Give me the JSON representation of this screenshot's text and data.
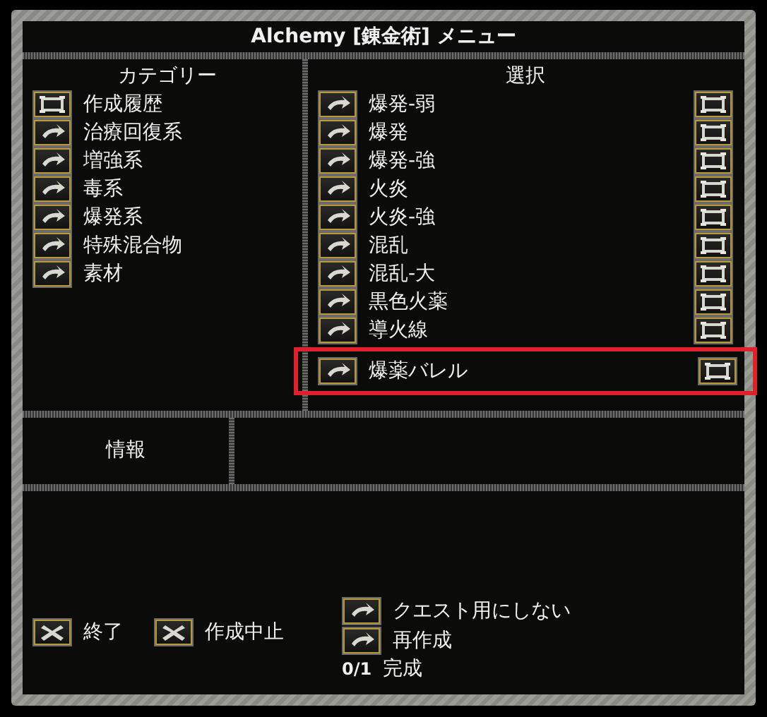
{
  "window": {
    "title": "Alchemy [錬金術] メニュー"
  },
  "category": {
    "heading": "カテゴリー",
    "items": [
      {
        "label": "作成履歴",
        "kind": "list"
      },
      {
        "label": "治療回復系",
        "kind": "arrow"
      },
      {
        "label": "増強系",
        "kind": "arrow"
      },
      {
        "label": "毒系",
        "kind": "arrow"
      },
      {
        "label": "爆発系",
        "kind": "arrow"
      },
      {
        "label": "特殊混合物",
        "kind": "arrow"
      },
      {
        "label": "素材",
        "kind": "arrow"
      }
    ]
  },
  "selection": {
    "heading": "選択",
    "items": [
      {
        "label": "爆発-弱",
        "selected": false
      },
      {
        "label": "爆発",
        "selected": false
      },
      {
        "label": "爆発-強",
        "selected": false
      },
      {
        "label": "火炎",
        "selected": false
      },
      {
        "label": "火炎-強",
        "selected": false
      },
      {
        "label": "混乱",
        "selected": false
      },
      {
        "label": "混乱-大",
        "selected": false
      },
      {
        "label": "黒色火薬",
        "selected": false
      },
      {
        "label": "導火線",
        "selected": false
      },
      {
        "label": "爆薬バレル",
        "selected": true
      }
    ]
  },
  "info": {
    "label": "情報"
  },
  "actions": [
    {
      "label": "終了",
      "kind": "close"
    },
    {
      "label": "作成中止",
      "kind": "close"
    }
  ],
  "options": [
    {
      "label": "クエスト用にしない",
      "kind": "arrow"
    },
    {
      "label": "再作成",
      "kind": "arrow"
    }
  ],
  "progress": {
    "count": "0/1",
    "label": "完成"
  }
}
